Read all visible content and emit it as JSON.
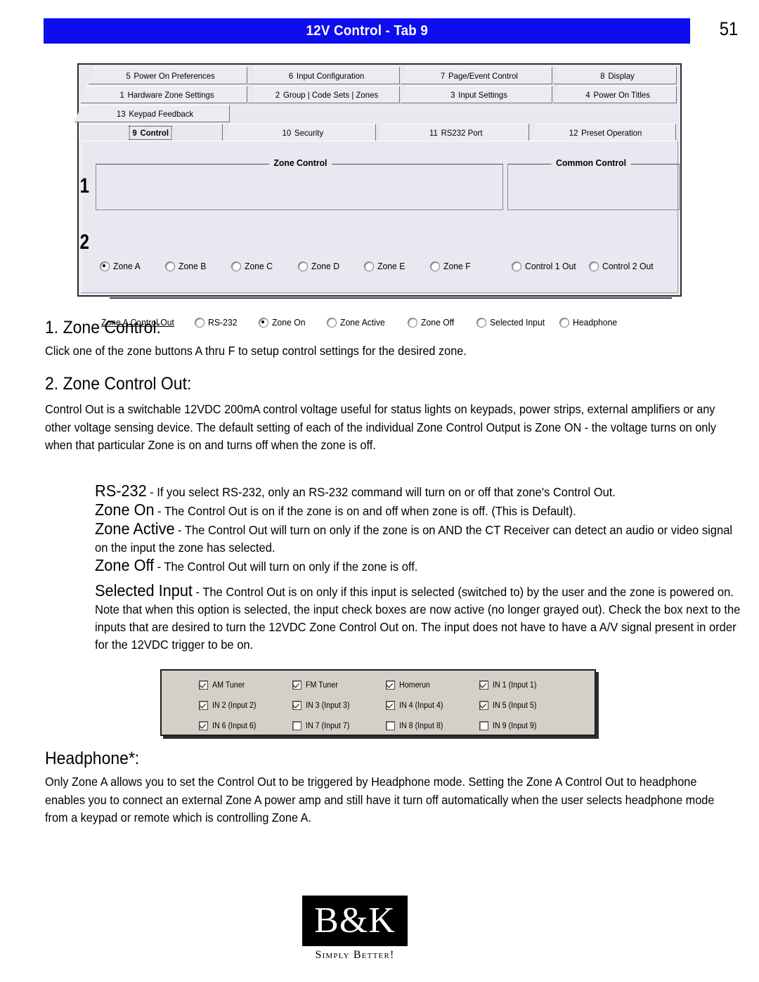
{
  "header": {
    "title": "12V Control - Tab 9",
    "page_number": "51",
    "bar_color": "#0d0df0"
  },
  "dialog": {
    "tab_rows": [
      [
        {
          "num": "5",
          "label": "Power On Preferences"
        },
        {
          "num": "6",
          "label": "Input Configuration"
        },
        {
          "num": "7",
          "label": "Page/Event Control"
        },
        {
          "num": "8",
          "label": "Display"
        }
      ],
      [
        {
          "num": "1",
          "label": "Hardware Zone Settings"
        },
        {
          "num": "2",
          "label": "Group | Code Sets | Zones"
        },
        {
          "num": "3",
          "label": "Input Settings"
        },
        {
          "num": "4",
          "label": "Power On Titles"
        }
      ],
      [
        {
          "num": "13",
          "label": "Keypad Feedback"
        }
      ],
      [
        {
          "num": "9",
          "label": "Control"
        },
        {
          "num": "10",
          "label": "Security"
        },
        {
          "num": "11",
          "label": "RS232 Port"
        },
        {
          "num": "12",
          "label": "Preset Operation"
        }
      ]
    ],
    "active_tab": "9  Control",
    "groups": {
      "zone_control_title": "Zone Control",
      "common_control_title": "Common Control"
    },
    "zone_radios": [
      {
        "label": "Zone A",
        "checked": true
      },
      {
        "label": "Zone B",
        "checked": false
      },
      {
        "label": "Zone C",
        "checked": false
      },
      {
        "label": "Zone D",
        "checked": false
      },
      {
        "label": "Zone E",
        "checked": false
      },
      {
        "label": "Zone F",
        "checked": false
      }
    ],
    "common_radios": [
      {
        "label": "Control 1 Out",
        "checked": false
      },
      {
        "label": "Control 2 Out",
        "checked": false
      }
    ],
    "mode_label": "Zone A Control Out",
    "mode_radios": [
      {
        "label": "RS-232",
        "checked": false
      },
      {
        "label": "Zone On",
        "checked": true
      },
      {
        "label": "Zone Active",
        "checked": false
      },
      {
        "label": "Zone Off",
        "checked": false
      },
      {
        "label": "Selected Input",
        "checked": false
      },
      {
        "label": "Headphone",
        "checked": false
      }
    ],
    "annotations": {
      "one": "1",
      "two": "2"
    }
  },
  "sections": {
    "heading1": "1. Zone Control:",
    "para1": "Click one of the zone buttons A thru F to setup control settings for the desired zone.",
    "heading2": "2. Zone Control Out:",
    "para2": "Control Out is a switchable 12VDC 200mA control voltage useful for status lights on keypads, power strips, external amplifiers or any other voltage sensing device. The default setting of each of the individual Zone Control Output is Zone ON - the voltage turns on only when that particular Zone is on and turns off when the zone is off.",
    "definitions": [
      {
        "term": "RS-232",
        "body": "- If you select RS-232, only an RS-232 command will turn on or off that zone's Control Out."
      },
      {
        "term": "Zone On",
        "body": "- The Control Out is on if the zone is on and off when zone is off. (This is Default)."
      },
      {
        "term": "Zone Active",
        "body": "- The Control Out will turn on only if the zone is on AND the CT Receiver can detect an audio or video signal on the input the zone has selected."
      },
      {
        "term": "Zone Off",
        "body": "- The Control Out will turn on only if the zone is off."
      }
    ],
    "selected_input": {
      "term": "Selected Input",
      "body": "- The Control Out is on only if this input is selected (switched to) by the user and the zone is powered on. Note that when this option is selected, the input check boxes are now active (no longer grayed out). Check the box next to the inputs that are desired to turn the 12VDC Zone Control Out on. The input does not have to have a A/V signal present in order for the 12VDC trigger to be on."
    },
    "heading3": "Headphone*:",
    "para3": "Only Zone A allows you to set the Control Out to be triggered by Headphone mode. Setting the Zone A Control Out to headphone enables you to connect an external Zone A power amp and still have it turn off automatically when the user selects headphone mode from a keypad or remote which is controlling Zone A."
  },
  "input_checkboxes": [
    [
      {
        "label": "AM Tuner",
        "checked": true
      },
      {
        "label": "FM Tuner",
        "checked": true
      },
      {
        "label": "Homerun",
        "checked": true
      },
      {
        "label": "IN 1 (Input 1)",
        "checked": true
      }
    ],
    [
      {
        "label": "IN 2 (Input 2)",
        "checked": true
      },
      {
        "label": "IN 3 (Input 3)",
        "checked": true
      },
      {
        "label": "IN 4 (Input 4)",
        "checked": true
      },
      {
        "label": "IN 5 (Input 5)",
        "checked": true
      }
    ],
    [
      {
        "label": "IN 6 (Input 6)",
        "checked": true
      },
      {
        "label": "IN 7 (Input 7)",
        "checked": false
      },
      {
        "label": "IN 8 (Input 8)",
        "checked": false
      },
      {
        "label": "IN 9 (Input 9)",
        "checked": false
      }
    ]
  ],
  "logo": {
    "mark": "B&K",
    "tagline": "Simply Better!"
  }
}
